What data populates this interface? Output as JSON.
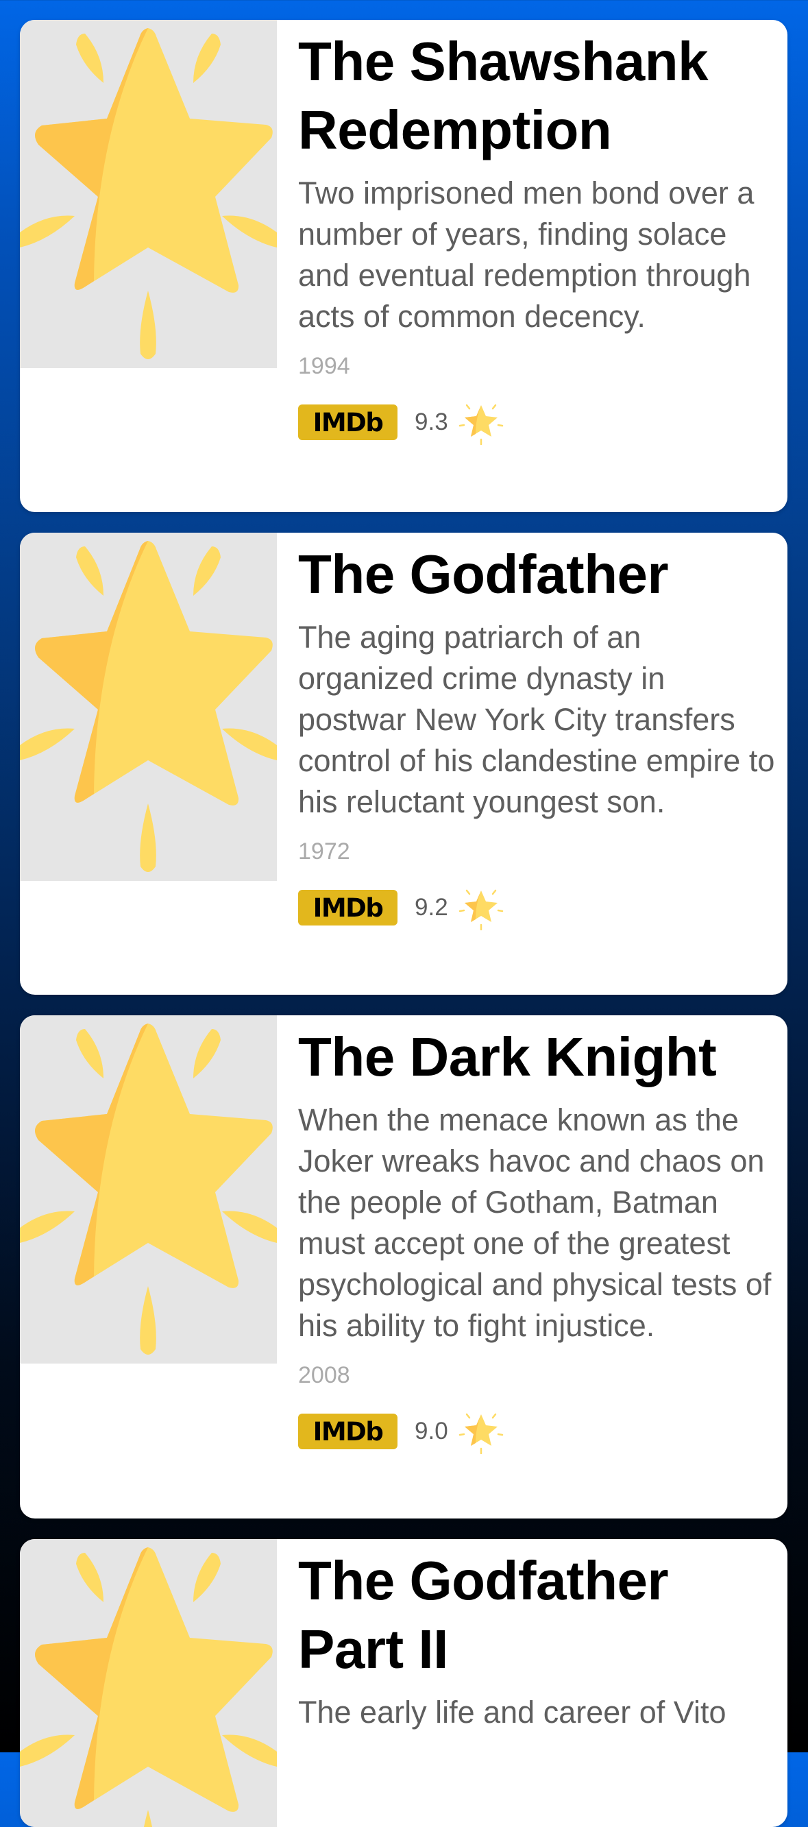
{
  "movies": [
    {
      "title": "The Shawshank Redemption",
      "description": "Two imprisoned men bond over a number of years, finding solace and eventual redemption through acts of common decency.",
      "year": "1994",
      "rating_source": "IMDb",
      "rating": "9.3",
      "poster_icon": "star-icon",
      "rating_icon": "star-icon"
    },
    {
      "title": "The Godfather",
      "description": "The aging patriarch of an organized crime dynasty in postwar New York City transfers control of his clandestine empire to his reluctant youngest son.",
      "year": "1972",
      "rating_source": "IMDb",
      "rating": "9.2",
      "poster_icon": "star-icon",
      "rating_icon": "star-icon"
    },
    {
      "title": "The Dark Knight",
      "description": "When the menace known as the Joker wreaks havoc and chaos on the people of Gotham, Batman must accept one of the greatest psychological and physical tests of his ability to fight injustice.",
      "year": "2008",
      "rating_source": "IMDb",
      "rating": "9.0",
      "poster_icon": "star-icon",
      "rating_icon": "star-icon"
    },
    {
      "title": "The Godfather Part II",
      "description": "The early life and career of Vito",
      "poster_icon": "star-icon"
    }
  ],
  "colors": {
    "background_top": "#0166e6",
    "background_bottom": "#000000",
    "card": "#ffffff",
    "poster_placeholder": "#e5e5e5",
    "imdb_badge": "#e2b71d",
    "star_light": "#fedb64",
    "star_dark": "#fdc54c",
    "title": "#000000",
    "description": "#5e5e5e",
    "year": "#aaaaaa"
  }
}
